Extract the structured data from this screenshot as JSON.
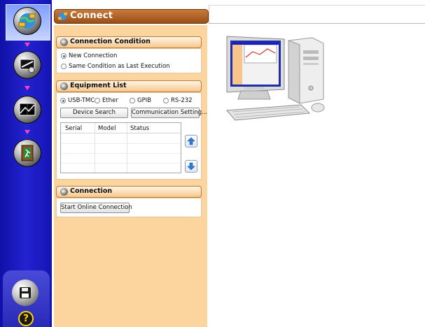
{
  "header": {
    "title": "Connect"
  },
  "sidebar": {
    "steps": [
      {
        "icon": "connect-globe-icon",
        "active": true
      },
      {
        "icon": "settings-tools-icon",
        "active": false
      },
      {
        "icon": "measurement-scope-icon",
        "active": false
      },
      {
        "icon": "exit-door-icon",
        "active": false
      }
    ],
    "save_icon": "floppy-disk-icon",
    "help_label": "?"
  },
  "connection_condition": {
    "title": "Connection Condition",
    "options": [
      {
        "label": "New Connection",
        "selected": true
      },
      {
        "label": "Same Condition as Last Execution",
        "selected": false
      }
    ]
  },
  "equipment_list": {
    "title": "Equipment List",
    "interfaces": [
      {
        "label": "USB-TMC",
        "selected": true
      },
      {
        "label": "Ether",
        "selected": false
      },
      {
        "label": "GPIB",
        "selected": false
      },
      {
        "label": "RS-232",
        "selected": false
      }
    ],
    "device_search_label": "Device Search",
    "communication_setting_label": "Communication Setting...",
    "columns": [
      "Serial",
      "Model",
      "Status"
    ],
    "rows": [],
    "move_up_icon": "arrow-up-icon",
    "move_down_icon": "arrow-down-icon"
  },
  "connection": {
    "title": "Connection",
    "start_label": "Start Online Connection"
  },
  "colors": {
    "nav_blue": "#1c1cc4",
    "panel_bg": "#fcd59e",
    "title_brown": "#a95a1e",
    "accent_pink": "#ff40c0"
  }
}
